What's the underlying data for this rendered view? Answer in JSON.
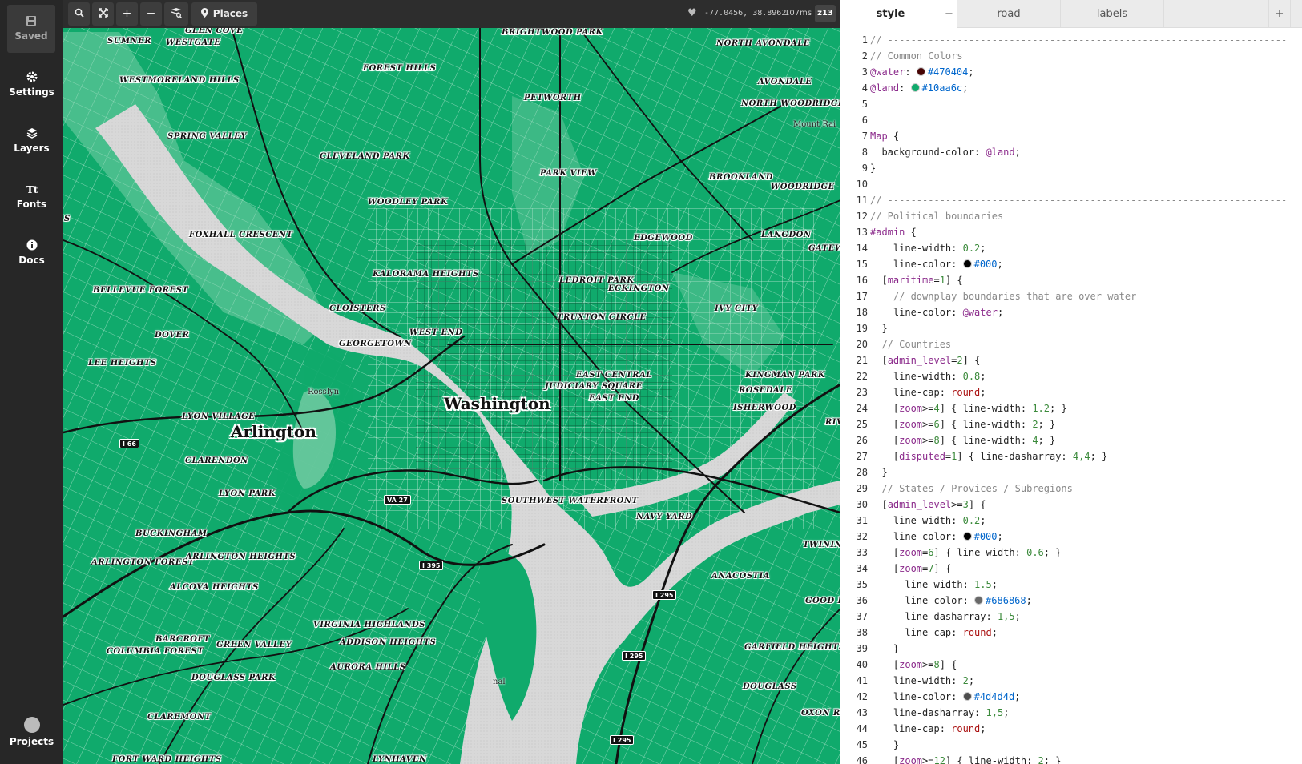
{
  "sidebar": {
    "saved": "Saved",
    "settings": "Settings",
    "layers": "Layers",
    "fonts": "Fonts",
    "docs": "Docs",
    "projects": "Projects"
  },
  "toolbar": {
    "places": "Places",
    "coords": "-77.0456, 38.8962",
    "render_time": "107ms",
    "zoom": "z13"
  },
  "map": {
    "city_labels": [
      "Washington",
      "Arlington"
    ],
    "minor_labels": [
      "Rosslyn",
      "Mount Rai",
      "nal"
    ],
    "shields": [
      "I 66",
      "VA 27",
      "I 395",
      "I 295",
      "I 295",
      "I 295"
    ],
    "neighborhoods": [
      "SUMNER",
      "WESTGATE",
      "GLEN COVE",
      "BRIGHTWOOD PARK",
      "NORTH AVONDALE",
      "FOREST HILLS",
      "WESTMORELAND HILLS",
      "AVONDALE",
      "PETWORTH",
      "NORTH WOODRIDGE",
      "SPRING VALLEY",
      "CLEVELAND PARK",
      "PARK VIEW",
      "BROOKLAND",
      "WOODRIDGE",
      "WOODLEY PARK",
      "FOXHALL CRESCENT",
      "EDGEWOOD",
      "LANGDON",
      "GATEW",
      "KALORAMA HEIGHTS",
      "LEDROIT PARK",
      "ECKINGTON",
      "BELLEVUE FOREST",
      "CLOISTERS",
      "TRUXTON CIRCLE",
      "IVY CITY",
      "DOVER",
      "WEST END",
      "GEORGETOWN",
      "LEE HEIGHTS",
      "EAST CENTRAL",
      "JUDICIARY SQUARE",
      "KINGMAN PARK",
      "ROSEDALE",
      "EAST END",
      "ISHERWOOD",
      "LYON VILLAGE",
      "RIV",
      "CLARENDON",
      "LYON PARK",
      "SOUTHWEST WATERFRONT",
      "NAVY YARD",
      "BUCKINGHAM",
      "TWINING",
      "ARLINGTON FOREST",
      "ARLINGTON HEIGHTS",
      "ANACOSTIA",
      "ALCOVA HEIGHTS",
      "GOOD H",
      "VIRGINIA HIGHLANDS",
      "BARCROFT",
      "ADDISON HEIGHTS",
      "GREEN VALLEY",
      "COLUMBIA FOREST",
      "GARFIELD HEIGHTS",
      "AURORA HILLS",
      "DOUGLASS PARK",
      "DOUGLASS",
      "CLAREMONT",
      "OXON R",
      "FORT WARD HEIGHTS",
      "LYNHAVEN",
      "S"
    ],
    "colors": {
      "land": "#10aa6c",
      "water": "#d8d8d8",
      "park": "#1dbb7a",
      "road": "#111111"
    }
  },
  "editor": {
    "tabs": [
      "style",
      "road",
      "labels"
    ],
    "close_label": "−",
    "add_label": "+",
    "lines": [
      "// ---------------------------------------------------------------------",
      "// Common Colors",
      "@water: #470404;",
      "@land: #10aa6c;",
      "",
      "",
      "Map {",
      "  background-color: @land;",
      "}",
      "",
      "// ---------------------------------------------------------------------",
      "// Political boundaries",
      "#admin {",
      "    line-width: 0.2;",
      "    line-color: #000;",
      "  [maritime=1] {",
      "    // downplay boundaries that are over water",
      "    line-color: @water;",
      "  }",
      "  // Countries",
      "  [admin_level=2] {",
      "    line-width: 0.8;",
      "    line-cap: round;",
      "    [zoom>=4] { line-width: 1.2; }",
      "    [zoom>=6] { line-width: 2; }",
      "    [zoom>=8] { line-width: 4; }",
      "    [disputed=1] { line-dasharray: 4,4; }",
      "  }",
      "  // States / Provices / Subregions",
      "  [admin_level>=3] {",
      "    line-width: 0.2;",
      "    line-color: #000;",
      "    [zoom=6] { line-width: 0.6; }",
      "    [zoom=7] {",
      "      line-width: 1.5;",
      "      line-color: #686868;",
      "      line-dasharray: 1,5;",
      "      line-cap: round;",
      "    }",
      "    [zoom>=8] {",
      "    line-width: 2;",
      "    line-color: #4d4d4d;",
      "    line-dasharray: 1,5;",
      "    line-cap: round;",
      "    }",
      "    [zoom>=12] { line-width: 2; }"
    ]
  }
}
